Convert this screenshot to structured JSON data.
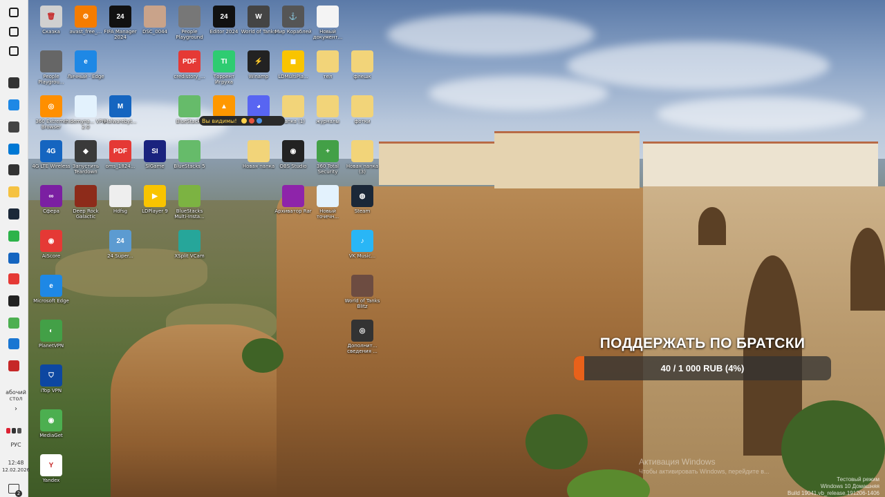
{
  "taskbar": {
    "items": [
      {
        "name": "windows-start-icon",
        "color": "#1a1a1a"
      },
      {
        "name": "search-icon",
        "color": "#1a1a1a"
      },
      {
        "name": "task-view-icon",
        "color": "#1a1a1a"
      },
      {
        "name": "world-of-tanks-taskbar-icon",
        "color": "#333333"
      },
      {
        "name": "edge-taskbar-icon",
        "color": "#1e88e5"
      },
      {
        "name": "warships-taskbar-icon",
        "color": "#444444"
      },
      {
        "name": "edge-blue-taskbar-icon",
        "color": "#0078d4"
      },
      {
        "name": "tanks-taskbar-icon",
        "color": "#333333"
      },
      {
        "name": "folder-taskbar-icon",
        "color": "#f5c242"
      },
      {
        "name": "steam-taskbar-icon",
        "color": "#1b2838"
      },
      {
        "name": "browser-360-taskbar-icon",
        "color": "#2db34a"
      },
      {
        "name": "shield-taskbar-icon",
        "color": "#1565c0"
      },
      {
        "name": "yandex-taskbar-icon",
        "color": "#e53935"
      },
      {
        "name": "game-taskbar-icon",
        "color": "#222222"
      },
      {
        "name": "window-taskbar-icon",
        "color": "#4caf50"
      },
      {
        "name": "network-taskbar-icon",
        "color": "#1976d2"
      },
      {
        "name": "media-taskbar-icon",
        "color": "#c62828"
      }
    ],
    "desktop_label": "абочий стол",
    "chevron": "›",
    "language": "РУС",
    "time": "12:48",
    "date": "12.02.2026",
    "notification_badge": "2"
  },
  "desktop_icons": [
    {
      "label": "Сказка",
      "color": "#d0d0d0",
      "glyph": "🗑"
    },
    {
      "label": "avast_free_...",
      "color": "#f57c00",
      "glyph": "⚙"
    },
    {
      "label": "FIFA Manager 2024",
      "color": "#111111",
      "glyph": "24"
    },
    {
      "label": "DSC_0044",
      "color": "#c9a38a",
      "glyph": ""
    },
    {
      "label": "People Playground",
      "color": "#777777",
      "glyph": ""
    },
    {
      "label": "Editor 2024",
      "color": "#111111",
      "glyph": "24"
    },
    {
      "label": "World of Tanks",
      "color": "#444444",
      "glyph": "W"
    },
    {
      "label": "Мир Кораблей",
      "color": "#555555",
      "glyph": "⚓"
    },
    {
      "label": "Новый документ...",
      "color": "#f4f4f4",
      "glyph": ""
    },
    {
      "label": "People Playgrou...",
      "color": "#666666",
      "glyph": ""
    },
    {
      "label": "Личный - Edge",
      "color": "#1e88e5",
      "glyph": "e"
    },
    {
      "label": "credistory_...",
      "color": "#e53935",
      "glyph": "PDF"
    },
    {
      "label": "Торрент Игруха",
      "color": "#2ecc71",
      "glyph": "TI"
    },
    {
      "label": "Winamp",
      "color": "#222222",
      "glyph": "⚡"
    },
    {
      "label": "LDMultiPla...",
      "color": "#f9c400",
      "glyph": "◼"
    },
    {
      "label": "тел",
      "color": "#f2d479",
      "glyph": ""
    },
    {
      "label": "флешк",
      "color": "#f2d479",
      "glyph": ""
    },
    {
      "label": "360 Extreme Browser",
      "color": "#ff8f00",
      "glyph": "◎"
    },
    {
      "label": "hidemyna... VPN 2.0",
      "color": "#e3f2fd",
      "glyph": ""
    },
    {
      "label": "Malwarebyt...",
      "color": "#1565c0",
      "glyph": "M"
    },
    {
      "label": "BlueStacks",
      "color": "#66bb6a",
      "glyph": ""
    },
    {
      "label": "player",
      "color": "#ff9800",
      "glyph": "▲"
    },
    {
      "label": "Discord",
      "color": "#5865f2",
      "glyph": "◕"
    },
    {
      "label": "папка (1)",
      "color": "#f2d479",
      "glyph": ""
    },
    {
      "label": "журналы",
      "color": "#f2d479",
      "glyph": ""
    },
    {
      "label": "фотки",
      "color": "#f2d479",
      "glyph": ""
    },
    {
      "label": "4G LTE Wireless",
      "color": "#1565c0",
      "glyph": "4G"
    },
    {
      "label": "Запустить Teardown",
      "color": "#3a3a3a",
      "glyph": "◆"
    },
    {
      "label": "oms_1824...",
      "color": "#e53935",
      "glyph": "PDF"
    },
    {
      "label": "SIGame",
      "color": "#1a237e",
      "glyph": "SI"
    },
    {
      "label": "BlueStacks 5",
      "color": "#66bb6a",
      "glyph": ""
    },
    {
      "label": "Новая папка",
      "color": "#f2d479",
      "glyph": ""
    },
    {
      "label": "OBS Studio",
      "color": "#222222",
      "glyph": "◉"
    },
    {
      "label": "360 Total Security",
      "color": "#43a047",
      "glyph": "+"
    },
    {
      "label": "Новая папка (3)",
      "color": "#f2d479",
      "glyph": ""
    },
    {
      "label": "Сфера",
      "color": "#7b1fa2",
      "glyph": "∞"
    },
    {
      "label": "Deep Rock Galactic",
      "color": "#8d2b1a",
      "glyph": ""
    },
    {
      "label": "Hdfsg",
      "color": "#eeeeee",
      "glyph": ""
    },
    {
      "label": "LDPlayer 9",
      "color": "#f9c400",
      "glyph": "▶"
    },
    {
      "label": "BlueStacks Multi-Insta...",
      "color": "#7cb342",
      "glyph": ""
    },
    {
      "label": "Архиватор Rar",
      "color": "#8e24aa",
      "glyph": ""
    },
    {
      "label": "Новый точечн...",
      "color": "#e3f2fd",
      "glyph": ""
    },
    {
      "label": "Steam",
      "color": "#1b2838",
      "glyph": "◍"
    },
    {
      "label": "AiScore",
      "color": "#e53935",
      "glyph": "◉"
    },
    {
      "label": "24 Super...",
      "color": "#5c9bd1",
      "glyph": "24"
    },
    {
      "label": "XSplit VCam",
      "color": "#26a69a",
      "glyph": ""
    },
    {
      "label": "VK Music...",
      "color": "#29b6f6",
      "glyph": "♪"
    },
    {
      "label": "Microsoft Edge",
      "color": "#1e88e5",
      "glyph": "e"
    },
    {
      "label": "World of Tanks Blitz",
      "color": "#6d4c41",
      "glyph": ""
    },
    {
      "label": "PlanetVPN",
      "color": "#43a047",
      "glyph": "◐"
    },
    {
      "label": "Дополнит... сведения ...",
      "color": "#333333",
      "glyph": "◎"
    },
    {
      "label": "iTop VPN",
      "color": "#0d47a1",
      "glyph": "⛉"
    },
    {
      "label": "MediaGet",
      "color": "#4caf50",
      "glyph": "◉"
    },
    {
      "label": "Yandex",
      "color": "#ffffff",
      "glyph": "Y"
    }
  ],
  "alert_sticker": {
    "text": "Вы видимы!"
  },
  "donation": {
    "title": "ПОДДЕРЖАТЬ ПО БРАТСКИ",
    "progress_text": "40 / 1 000 RUB (4%)",
    "progress_percent": 4,
    "accent": "#e8611a"
  },
  "watermark": {
    "activation_title": "Активация Windows",
    "activation_sub": "Чтобы активировать Windows, перейдите в...",
    "mode": "Тестовый режим",
    "edition": "Windows 10 Домашняя",
    "build": "Build 19041.vb_release.191206-1406"
  }
}
